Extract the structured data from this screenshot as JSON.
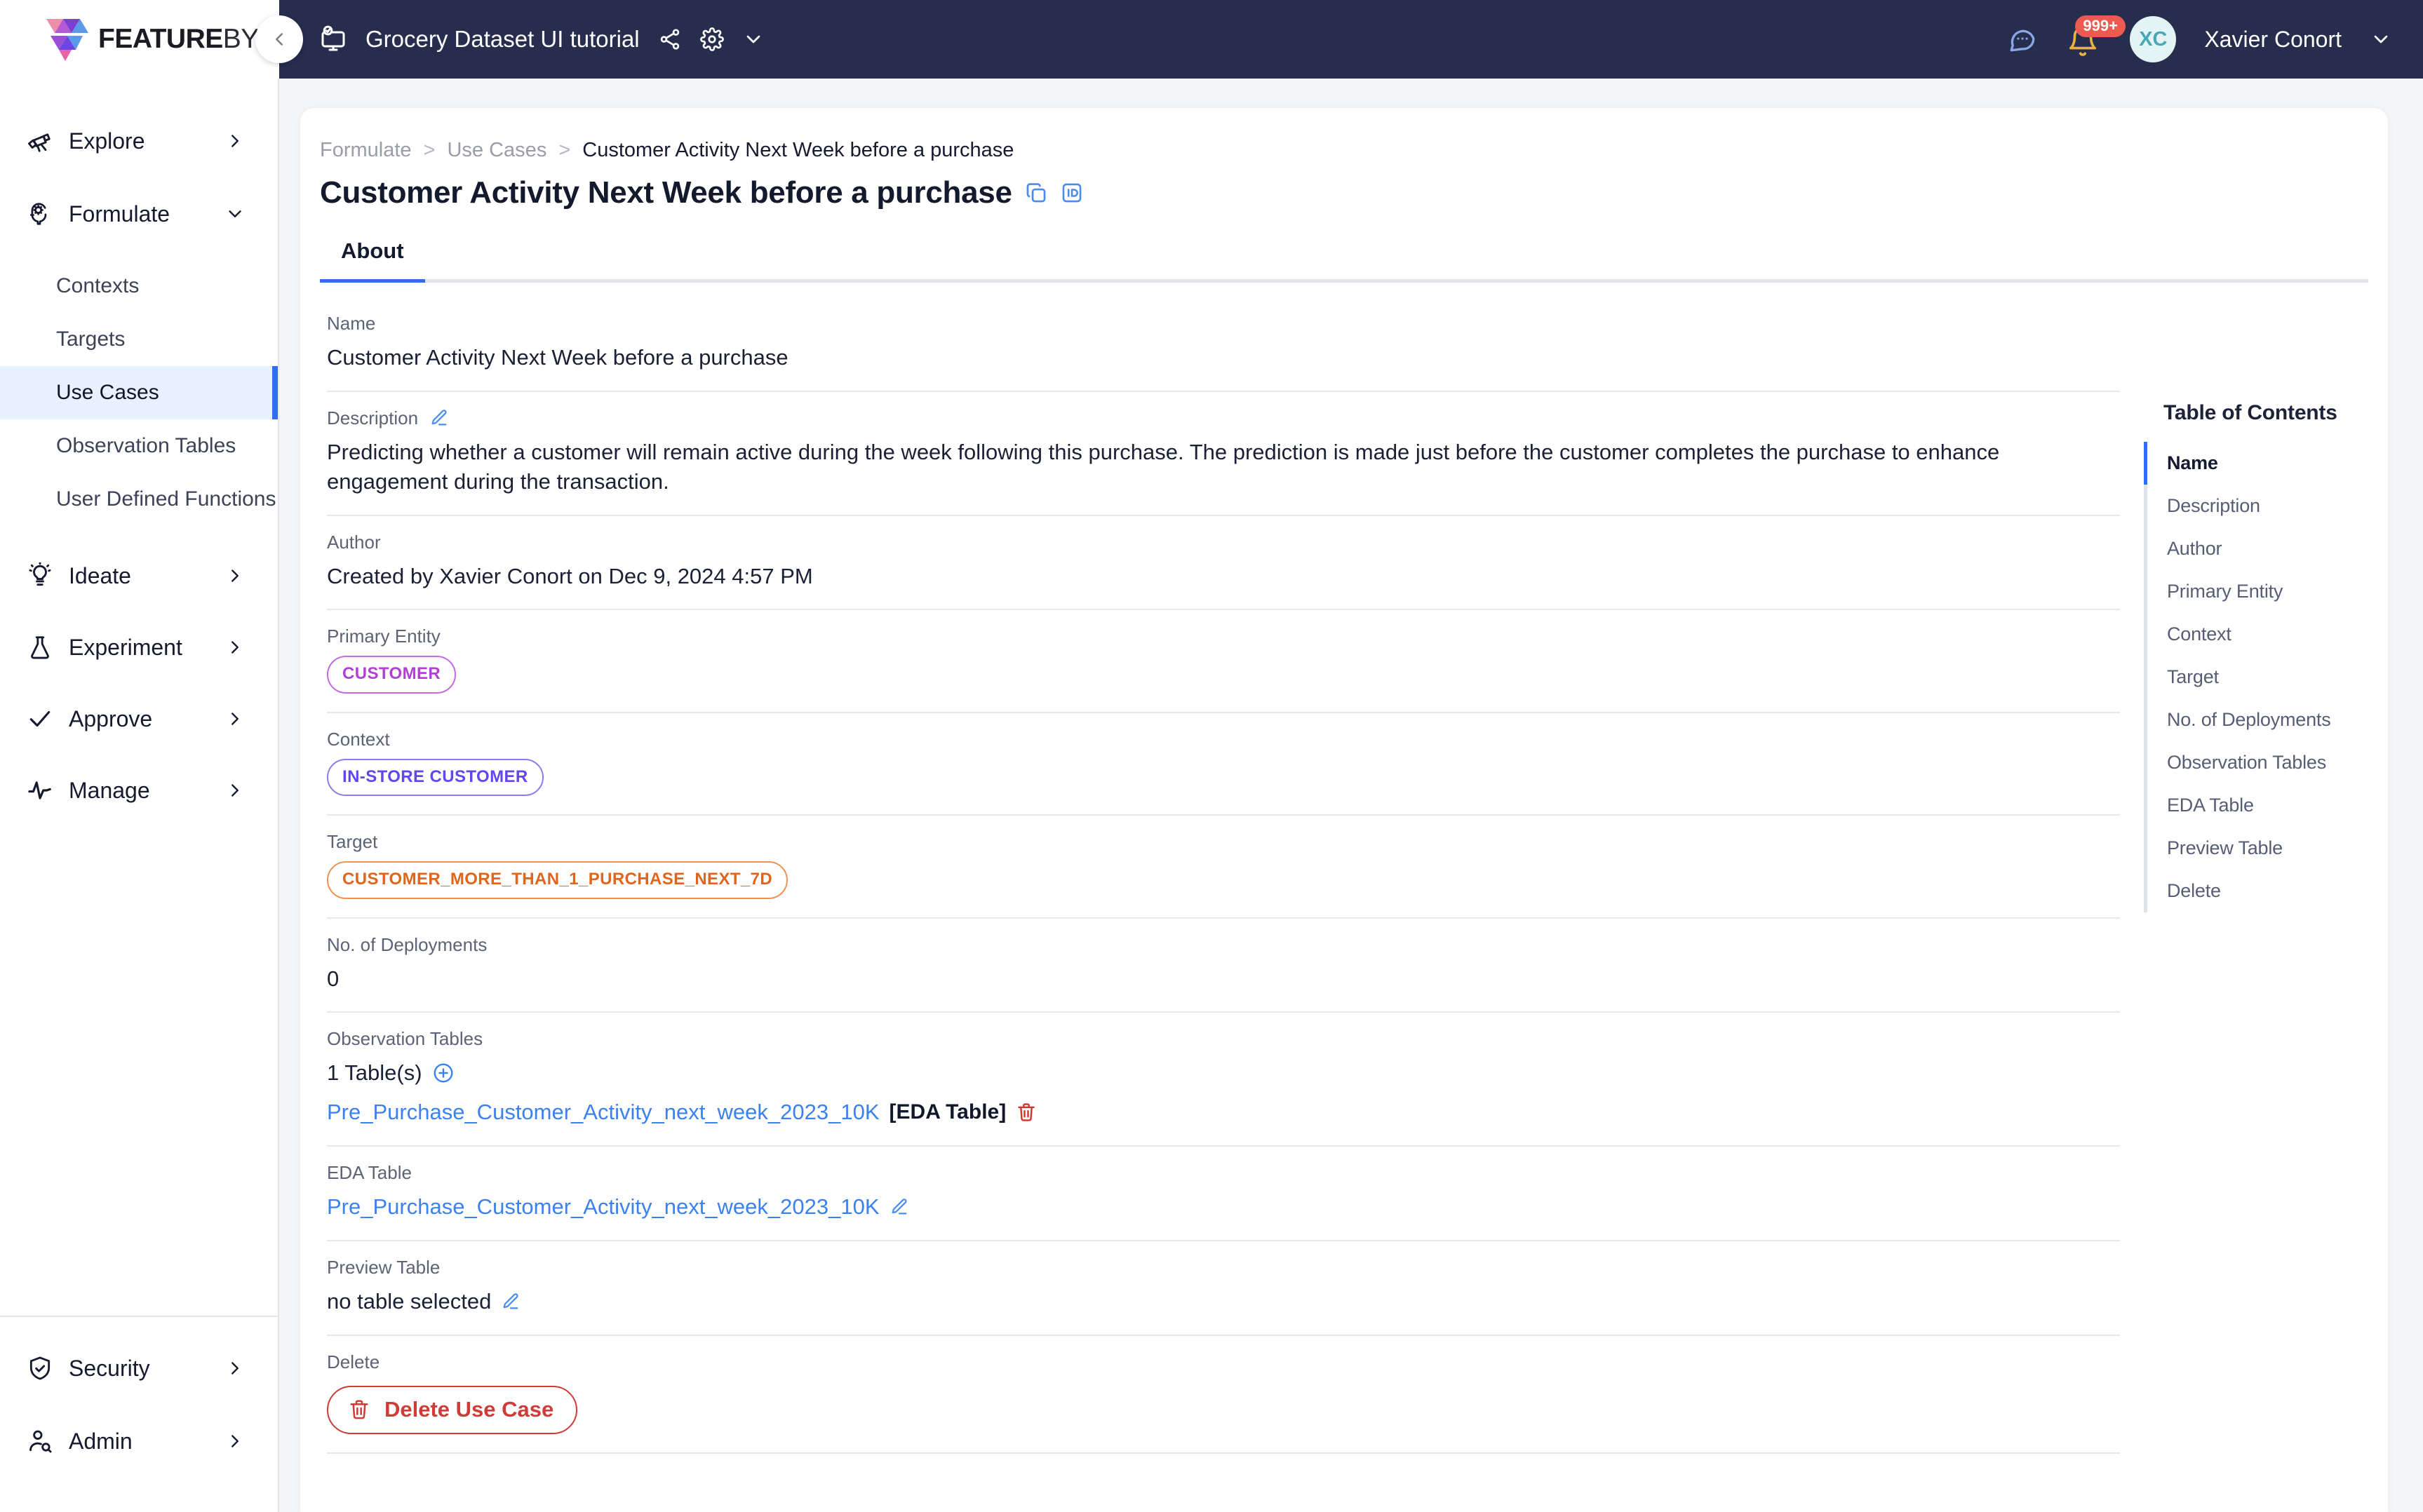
{
  "brand": {
    "name_left": "FEATURE",
    "name_right": "BYTE",
    "logo_icon": "featurebyte-logo"
  },
  "topbar": {
    "collapse_icon": "chevron-left-icon",
    "project_icon": "monitor-check-icon",
    "project_name": "Grocery Dataset UI tutorial",
    "share_icon": "share-icon",
    "settings_icon": "gear-icon",
    "caret_icon": "chevron-down-icon",
    "chat_icon": "chat-bubble-icon",
    "bell_icon": "bell-icon",
    "bell_badge": "999+",
    "avatar_initials": "XC",
    "user_name": "Xavier Conort",
    "user_caret_icon": "chevron-down-icon"
  },
  "sidebar": {
    "groups": [
      {
        "label": "Explore",
        "icon": "telescope-icon",
        "chevron": "chevron-right-icon",
        "expanded": false
      },
      {
        "label": "Formulate",
        "icon": "brain-gear-icon",
        "chevron": "chevron-down-icon",
        "expanded": true
      }
    ],
    "formulate_items": [
      {
        "label": "Contexts",
        "active": false
      },
      {
        "label": "Targets",
        "active": false
      },
      {
        "label": "Use Cases",
        "active": true
      },
      {
        "label": "Observation Tables",
        "active": false
      },
      {
        "label": "User Defined Functions",
        "active": false
      }
    ],
    "groups_lower": [
      {
        "label": "Ideate",
        "icon": "lightbulb-icon",
        "chevron": "chevron-right-icon"
      },
      {
        "label": "Experiment",
        "icon": "flask-icon",
        "chevron": "chevron-right-icon"
      },
      {
        "label": "Approve",
        "icon": "check-icon",
        "chevron": "chevron-right-icon"
      },
      {
        "label": "Manage",
        "icon": "pulse-icon",
        "chevron": "chevron-right-icon"
      }
    ],
    "bottom_items": [
      {
        "label": "Security",
        "icon": "shield-check-icon",
        "chevron": "chevron-right-icon"
      },
      {
        "label": "Admin",
        "icon": "user-search-icon",
        "chevron": "chevron-right-icon"
      }
    ]
  },
  "breadcrumb": {
    "l1": "Formulate",
    "sep": ">",
    "l2": "Use Cases",
    "l3": "Customer Activity Next Week before a purchase"
  },
  "header": {
    "title": "Customer Activity Next Week before a purchase",
    "copy_icon": "copy-icon",
    "id_icon": "id-badge-icon"
  },
  "tabs": {
    "about": "About"
  },
  "fields": {
    "name_label": "Name",
    "name_value": "Customer Activity Next Week before a purchase",
    "description_label": "Description",
    "description_edit_icon": "edit-pencil-icon",
    "description_value": "Predicting whether a customer will remain active during the week following this purchase. The prediction is made just before the customer completes the purchase to enhance engagement during the transaction.",
    "author_label": "Author",
    "author_value": "Created by Xavier Conort on Dec 9, 2024 4:57 PM",
    "primary_entity_label": "Primary Entity",
    "primary_entity_pill": "CUSTOMER",
    "context_label": "Context",
    "context_pill": "IN-STORE CUSTOMER",
    "target_label": "Target",
    "target_pill": "CUSTOMER_MORE_THAN_1_PURCHASE_NEXT_7D",
    "deployments_label": "No. of Deployments",
    "deployments_value": "0",
    "observation_tables_label": "Observation Tables",
    "observation_tables_count": "1 Table(s)",
    "observation_add_icon": "plus-circle-icon",
    "observation_table_link": "Pre_Purchase_Customer_Activity_next_week_2023_10K",
    "observation_table_tag": "[EDA Table]",
    "observation_delete_icon": "trash-icon",
    "eda_table_label": "EDA Table",
    "eda_table_link": "Pre_Purchase_Customer_Activity_next_week_2023_10K",
    "eda_edit_icon": "edit-pencil-icon",
    "preview_table_label": "Preview Table",
    "preview_table_value": "no table selected",
    "preview_edit_icon": "edit-pencil-icon",
    "delete_label": "Delete",
    "delete_button": "Delete Use Case",
    "delete_button_icon": "trash-icon"
  },
  "toc": {
    "title": "Table of Contents",
    "items": [
      {
        "label": "Name",
        "active": true
      },
      {
        "label": "Description",
        "active": false
      },
      {
        "label": "Author",
        "active": false
      },
      {
        "label": "Primary Entity",
        "active": false
      },
      {
        "label": "Context",
        "active": false
      },
      {
        "label": "Target",
        "active": false
      },
      {
        "label": "No. of Deployments",
        "active": false
      },
      {
        "label": "Observation Tables",
        "active": false
      },
      {
        "label": "EDA Table",
        "active": false
      },
      {
        "label": "Preview Table",
        "active": false
      },
      {
        "label": "Delete",
        "active": false
      }
    ]
  },
  "colors": {
    "accent": "#2f6fed",
    "topbar": "#262d4d",
    "danger": "#cf3b36",
    "link": "#3b82f0"
  }
}
